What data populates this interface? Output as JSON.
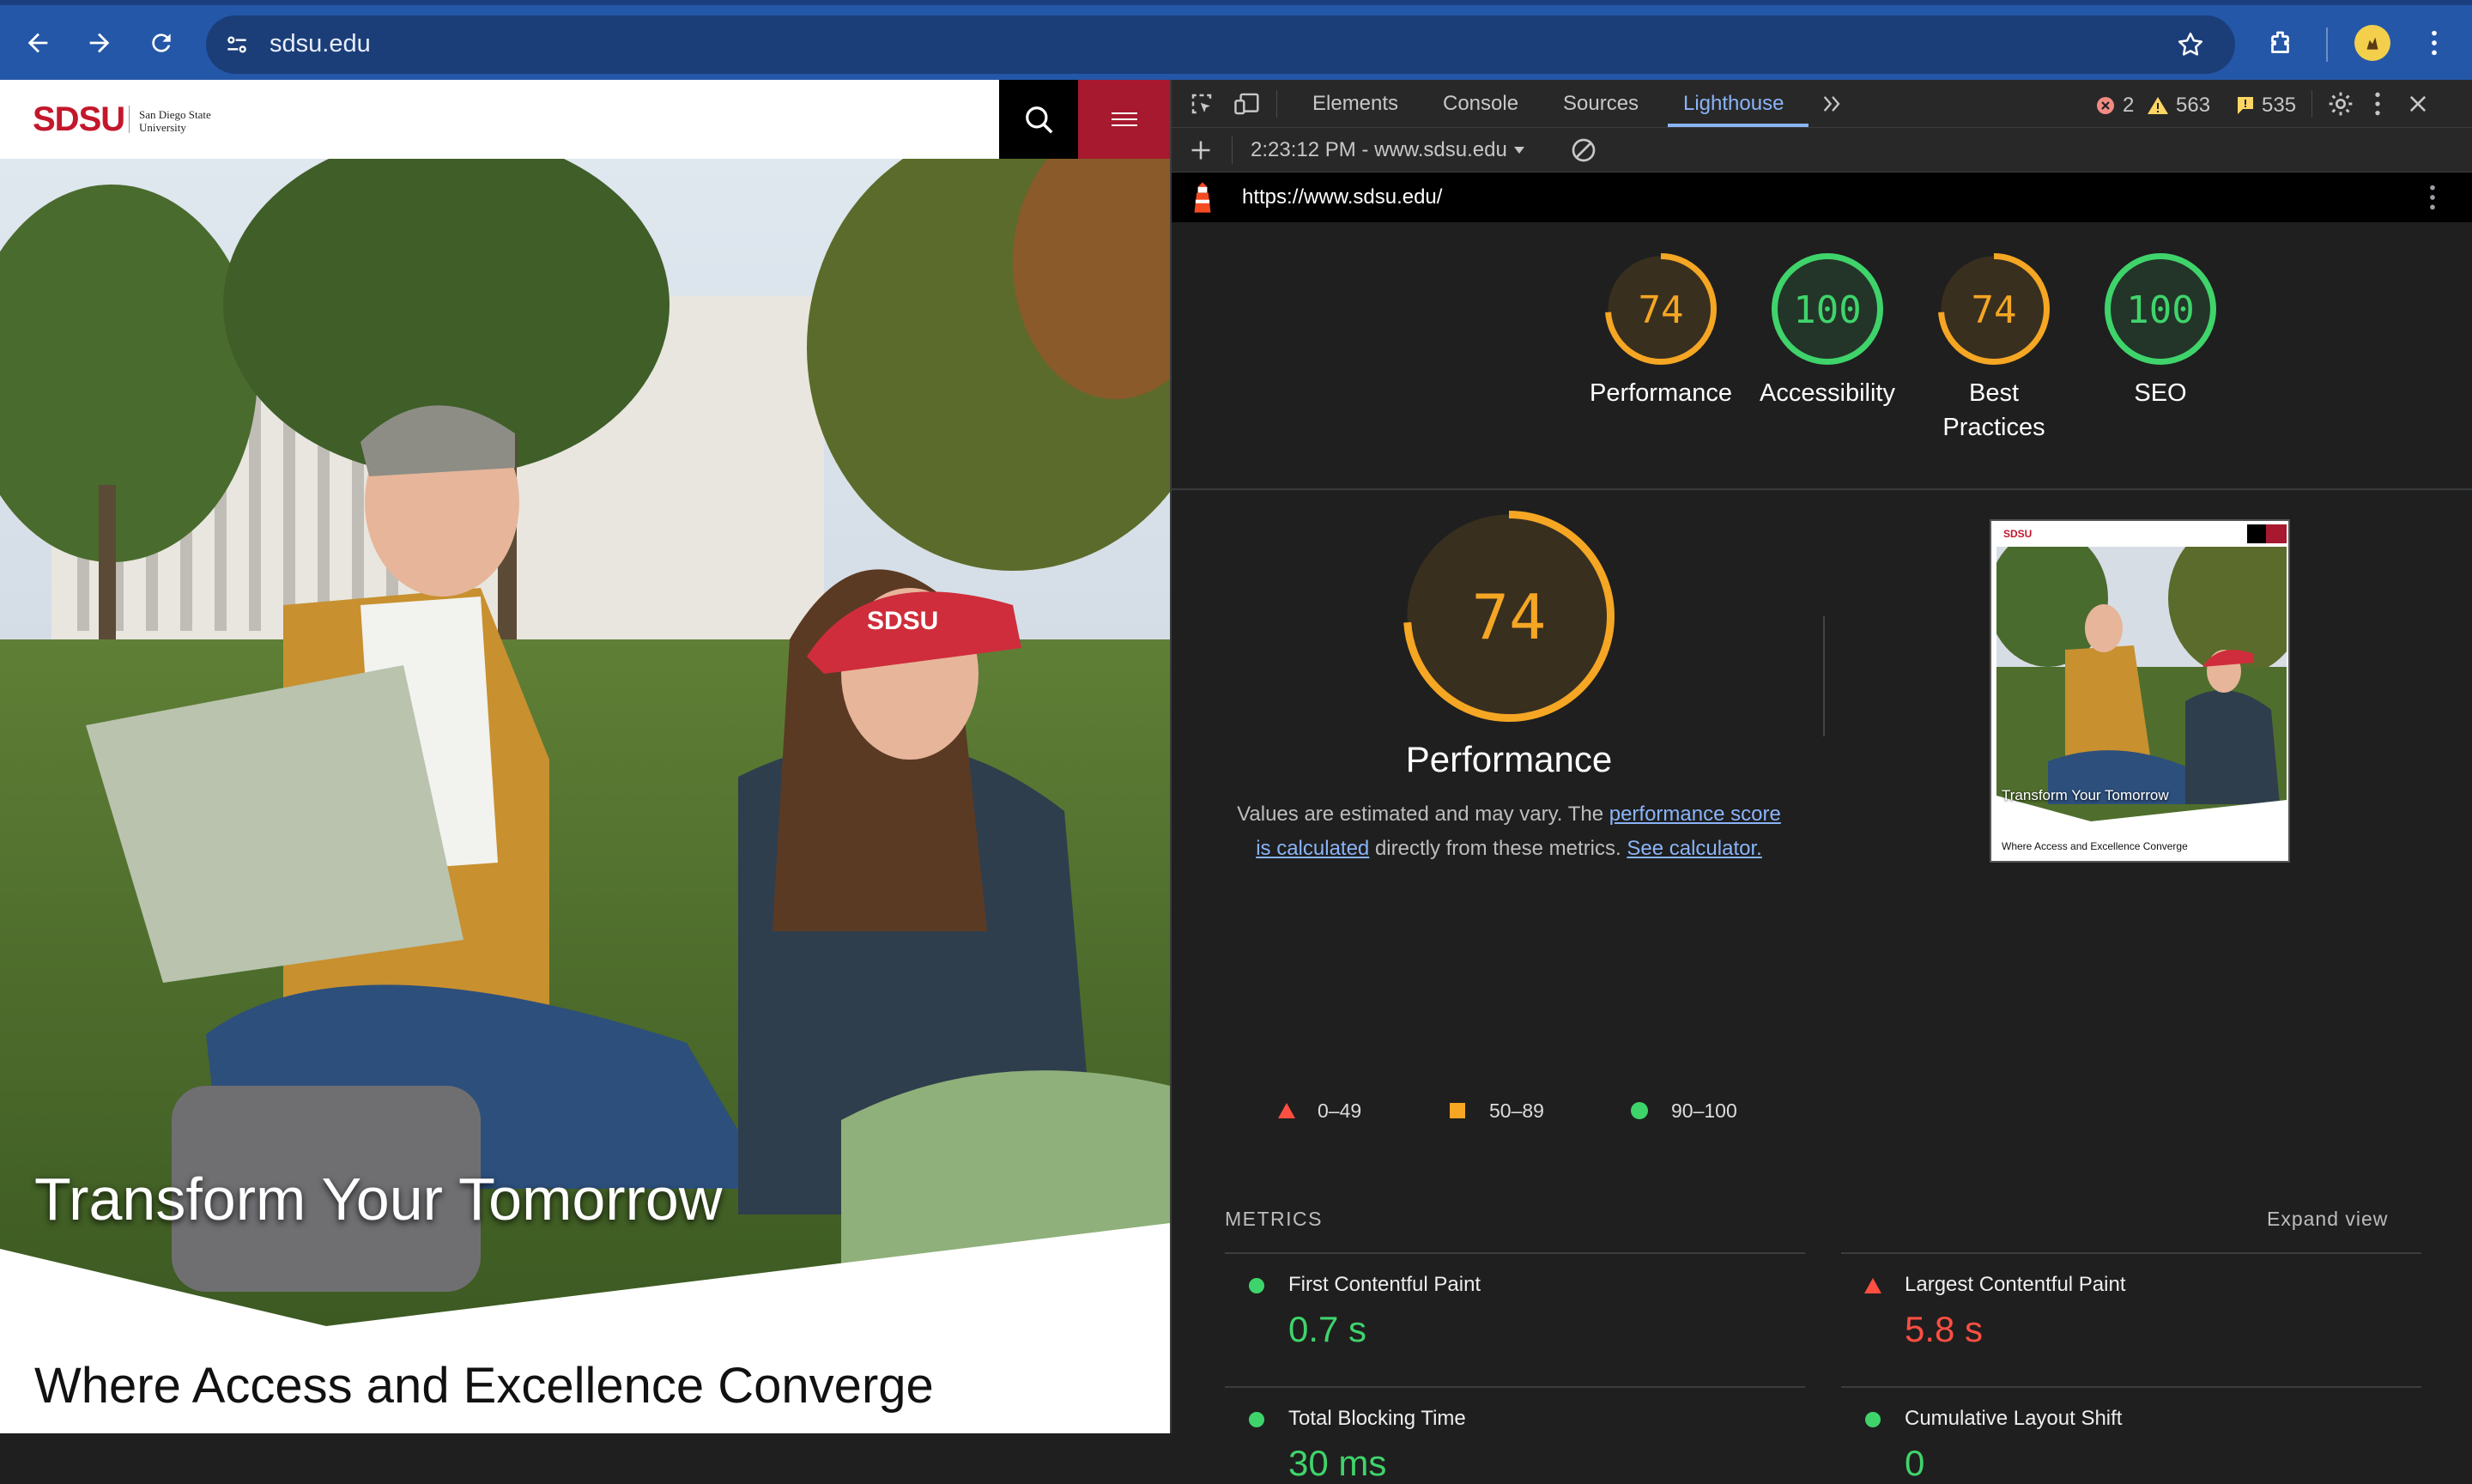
{
  "browser": {
    "url": "sdsu.edu",
    "icons": [
      "back-icon",
      "forward-icon",
      "reload-icon",
      "site-info-icon",
      "star-icon",
      "extensions-icon",
      "profile-icon",
      "more-icon"
    ]
  },
  "site": {
    "logo": "SDSU",
    "logo_subtitle_line1": "San Diego State",
    "logo_subtitle_line2": "University",
    "hero_title": "Transform Your Tomorrow",
    "tagline": "Where Access and Excellence Converge",
    "cap_text": "SDSU",
    "brand_color": "#a6192e"
  },
  "devtools": {
    "tabs": [
      "Elements",
      "Console",
      "Sources",
      "Lighthouse"
    ],
    "active_tab": "Lighthouse",
    "errors": "2",
    "warnings": "563",
    "issues": "535",
    "report_selector": "2:23:12 PM - www.sdsu.edu",
    "report_url": "https://www.sdsu.edu/"
  },
  "lighthouse": {
    "categories": [
      {
        "label": "Performance",
        "score": 74,
        "color": "#f5a623"
      },
      {
        "label": "Accessibility",
        "score": 100,
        "color": "#3fd46b"
      },
      {
        "label": "Best\nPractices",
        "score": 74,
        "color": "#f5a623"
      },
      {
        "label": "SEO",
        "score": 100,
        "color": "#3fd46b"
      }
    ],
    "perf_title": "Performance",
    "perf_score": 74,
    "desc_1": "Values are estimated and may vary. The ",
    "desc_link1a": "performance score",
    "desc_link1b": "is calculated",
    "desc_2": " directly from these metrics. ",
    "desc_link2": "See calculator.",
    "legend": [
      "0–49",
      "50–89",
      "90–100"
    ],
    "metrics_heading": "METRICS",
    "expand_view": "Expand view",
    "metrics": [
      {
        "name": "First Contentful Paint",
        "value": "0.7 s",
        "status": "good"
      },
      {
        "name": "Largest Contentful Paint",
        "value": "5.8 s",
        "status": "poor"
      },
      {
        "name": "Total Blocking Time",
        "value": "30 ms",
        "status": "good"
      },
      {
        "name": "Cumulative Layout Shift",
        "value": "0",
        "status": "good"
      }
    ],
    "thumb_logo": "SDSU",
    "thumb_hero": "Transform Your Tomorrow",
    "thumb_tagline": "Where Access and Excellence Converge"
  }
}
